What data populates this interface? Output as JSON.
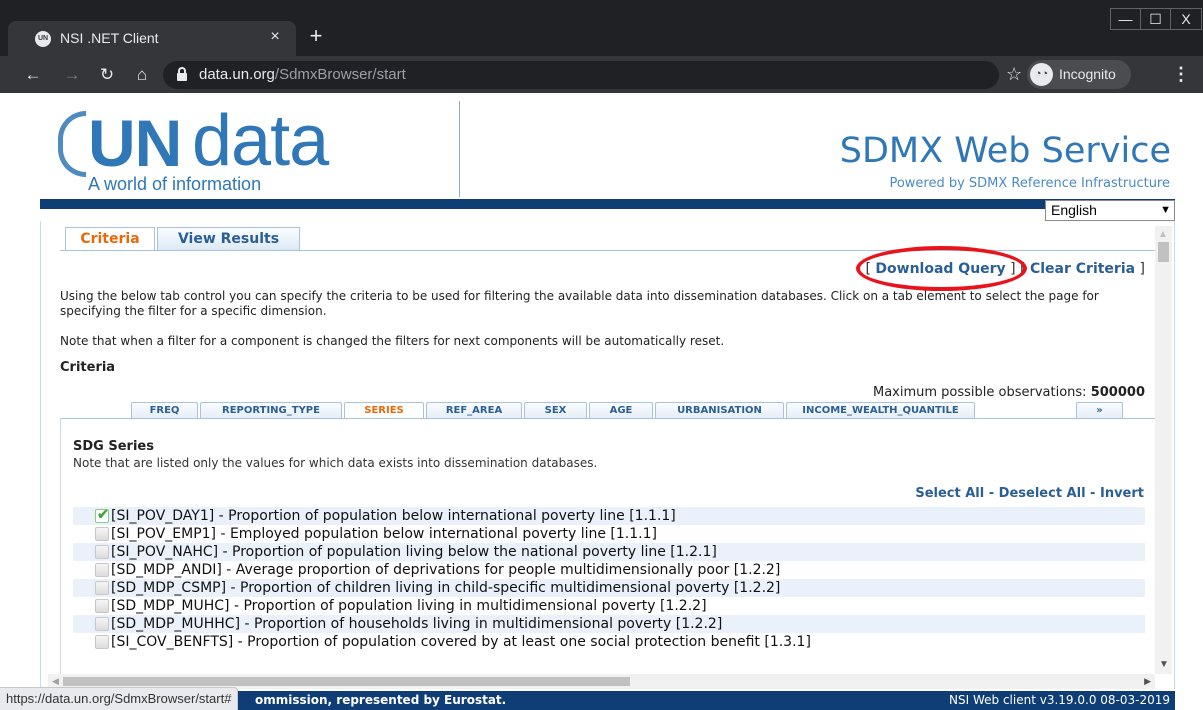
{
  "browser": {
    "tab_title": "NSI .NET Client",
    "tab_favicon_label": "UN",
    "close_glyph": "×",
    "newtab_glyph": "+",
    "window_controls": [
      "—",
      "☐",
      "X"
    ],
    "url_host": "data.un.org",
    "url_path": "/SdmxBrowser/start",
    "incognito_label": "Incognito",
    "status_url": "https://data.un.org/SdmxBrowser/start#"
  },
  "header": {
    "logo_un": "UN",
    "logo_data": "data",
    "tagline": "A world of information",
    "service_title": "SDMX Web Service",
    "service_subtitle": "Powered by SDMX Reference Infrastructure",
    "language": "English"
  },
  "main_tabs": [
    {
      "label": "Criteria",
      "active": true
    },
    {
      "label": "View Results",
      "active": false
    }
  ],
  "actions": {
    "download_query": "Download Query",
    "clear_criteria": "Clear Criteria"
  },
  "intro": {
    "line1": "Using the below tab control you can specify the criteria to be used for filtering the available data into dissemination databases. Click on a tab element to select the page for specifying the filter for a specific dimension.",
    "line2": "Note that when a filter for a component is changed the filters for next components will be automatically reset."
  },
  "criteria": {
    "heading": "Criteria",
    "max_obs_label": "Maximum possible observations:",
    "max_obs_value": "500000"
  },
  "dimension_tabs": [
    {
      "label": "FREQ",
      "active": false
    },
    {
      "label": "REPORTING_TYPE",
      "active": false
    },
    {
      "label": "SERIES",
      "active": true
    },
    {
      "label": "REF_AREA",
      "active": false
    },
    {
      "label": "SEX",
      "active": false
    },
    {
      "label": "AGE",
      "active": false
    },
    {
      "label": "URBANISATION",
      "active": false
    },
    {
      "label": "INCOME_WEALTH_QUANTILE",
      "active": false
    },
    {
      "label": "»",
      "active": false
    }
  ],
  "series_panel": {
    "title": "SDG Series",
    "note": "Note that are listed only the values for which data exists into dissemination databases.",
    "select_all": "Select All",
    "deselect_all": "Deselect All",
    "invert": "Invert",
    "sep": " - ",
    "items": [
      {
        "label": "[SI_POV_DAY1] - Proportion of population below international poverty line [1.1.1]",
        "checked": true
      },
      {
        "label": "[SI_POV_EMP1] - Employed population below international poverty line [1.1.1]",
        "checked": false
      },
      {
        "label": "[SI_POV_NAHC] - Proportion of population living below the national poverty line [1.2.1]",
        "checked": false
      },
      {
        "label": "[SD_MDP_ANDI] - Average proportion of deprivations for people multidimensionally poor [1.2.2]",
        "checked": false
      },
      {
        "label": "[SD_MDP_CSMP] - Proportion of children living in child-specific multidimensional poverty [1.2.2]",
        "checked": false
      },
      {
        "label": "[SD_MDP_MUHC] - Proportion of population living in multidimensional poverty [1.2.2]",
        "checked": false
      },
      {
        "label": "[SD_MDP_MUHHC] - Proportion of households living in multidimensional poverty [1.2.2]",
        "checked": false
      },
      {
        "label": "[SI_COV_BENFTS] - Proportion of population covered by at least one social protection benefit [1.3.1]",
        "checked": false
      }
    ]
  },
  "footer": {
    "left": "ommission, represented by Eurostat.",
    "right": "NSI Web client v3.19.0.0 08-03-2019"
  },
  "colors": {
    "brand_blue": "#2f77b6",
    "bar_blue": "#0f3e77",
    "active_tab": "#e66a0a",
    "link": "#2b5f94",
    "highlight_ring": "#e8141b"
  }
}
